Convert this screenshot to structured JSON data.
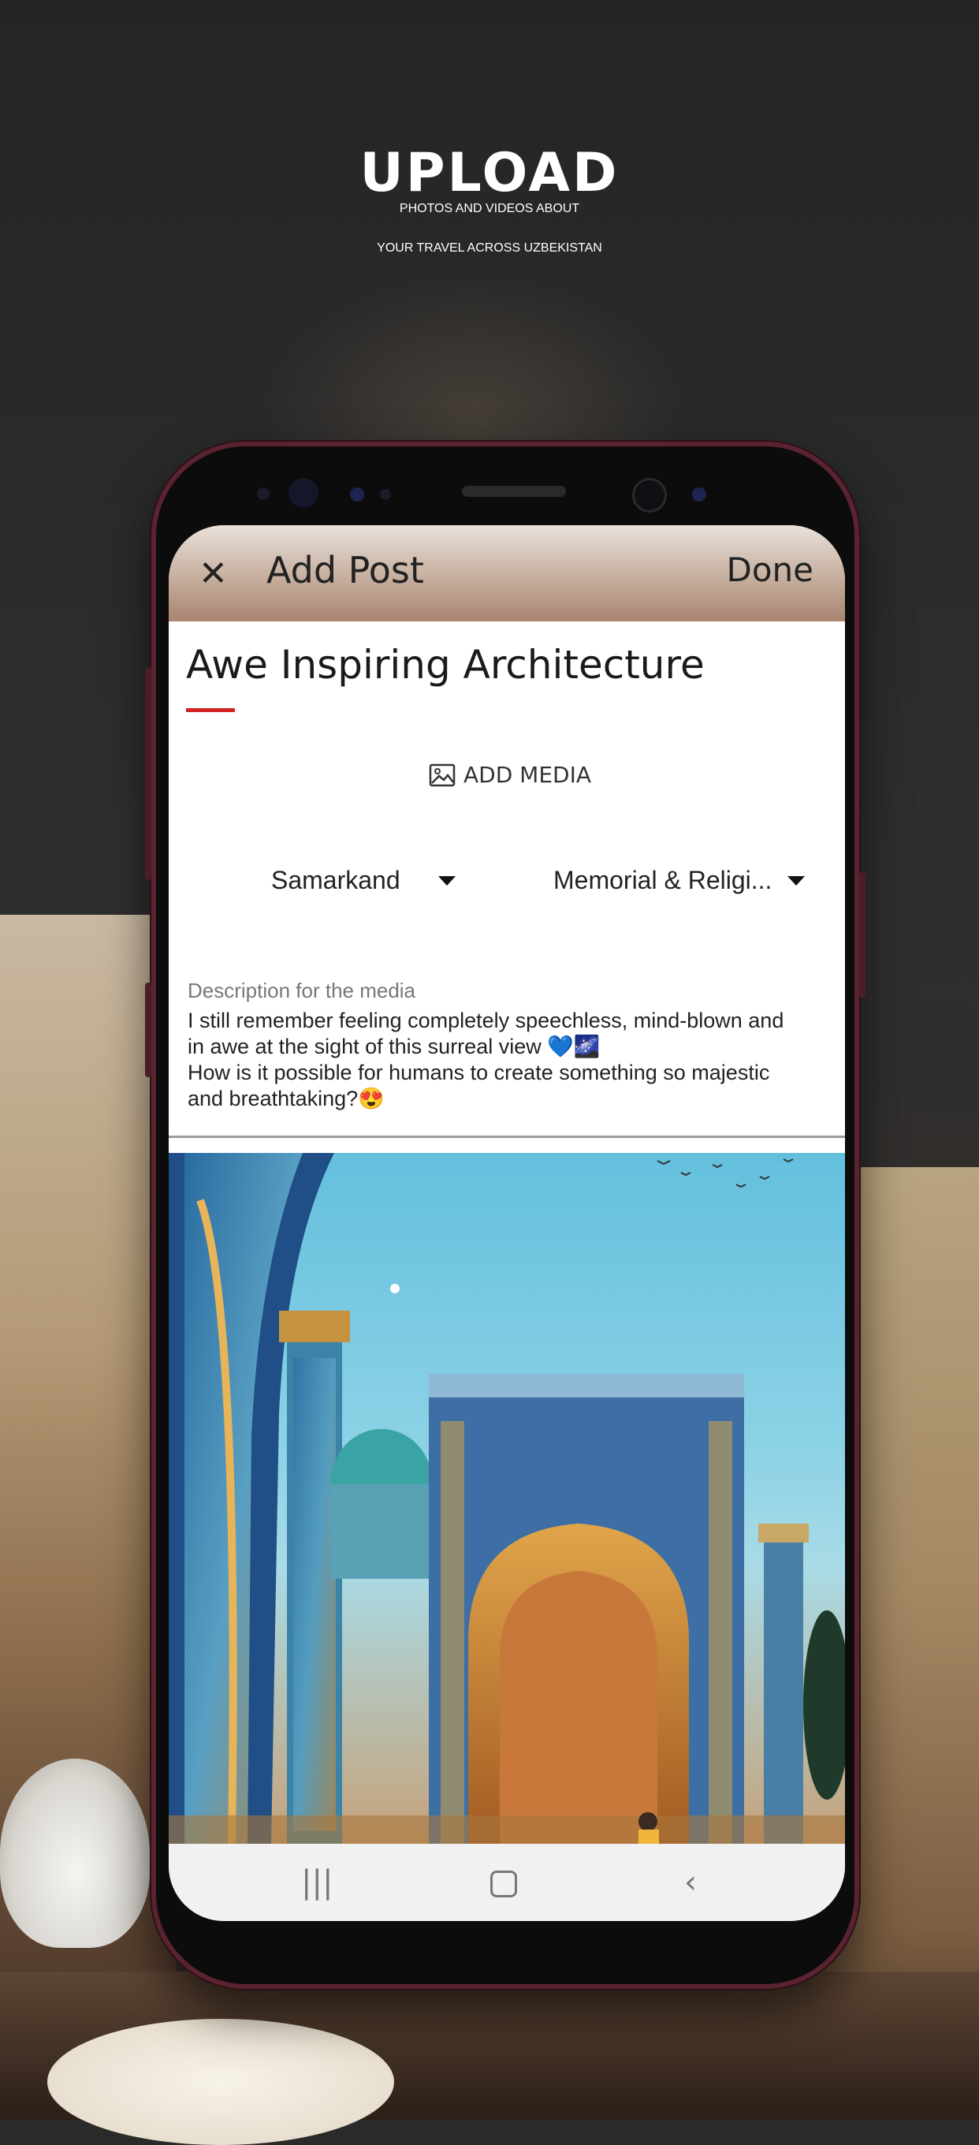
{
  "headline": {
    "title": "UPLOAD",
    "line1": "PHOTOS AND VIDEOS ABOUT",
    "line2": "YOUR TRAVEL ACROSS UZBEKISTAN"
  },
  "appbar": {
    "close_icon": "close-icon",
    "title": "Add Post",
    "done_label": "Done"
  },
  "post": {
    "title": "Awe Inspiring Architecture",
    "add_media_label": "ADD MEDIA",
    "add_media_icon": "image-icon",
    "city": "Samarkand",
    "category": "Memorial & Religi...",
    "description_label": "Description for the media",
    "description_line1": "I still remember feeling completely speechless, mind-blown and",
    "description_line2": "in awe at the sight of this surreal view 💙🌌",
    "description_line3": "How is it possible for humans to create something so majestic",
    "description_line4": "and breathtaking?😍"
  },
  "navbar": {
    "recents_icon": "recents-icon",
    "home_icon": "home-icon",
    "back_icon": "back-icon"
  },
  "colors": {
    "accent": "#d22424",
    "phone_frame": "#5a2330"
  }
}
